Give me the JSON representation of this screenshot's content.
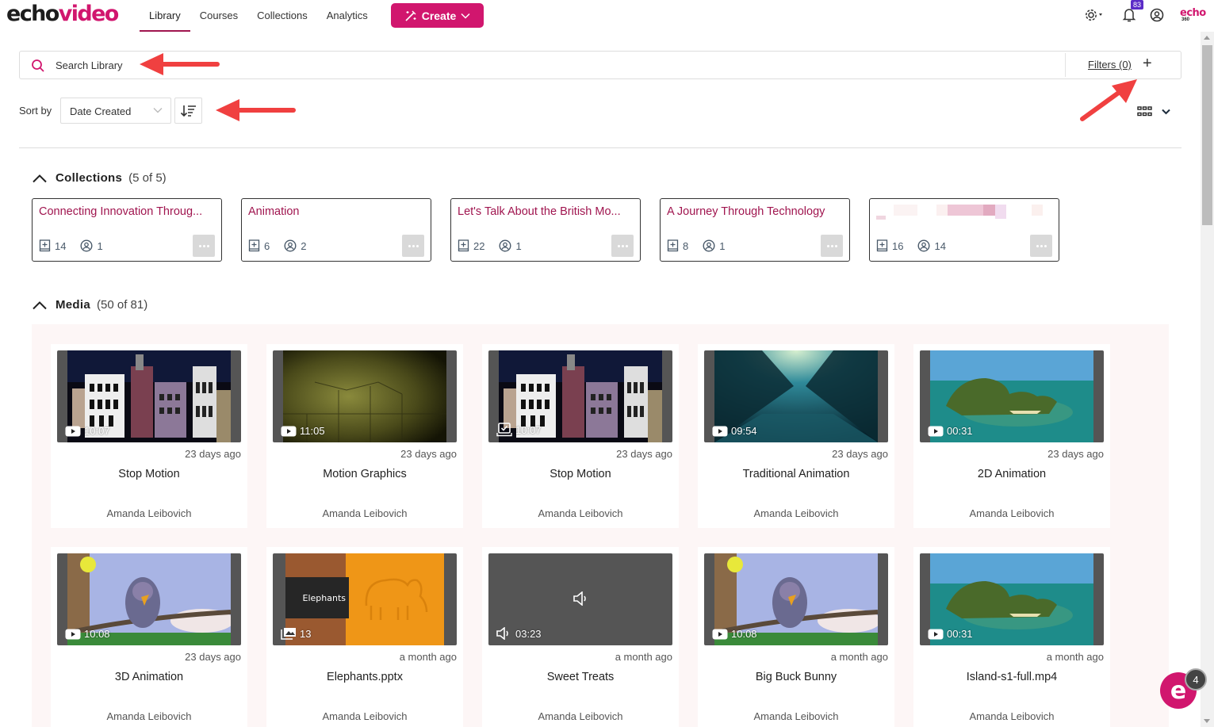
{
  "brand": {
    "logo_part1": "echo",
    "logo_part2": "video",
    "accent": "#d1166e",
    "secondary_logo_top": "echo",
    "secondary_logo_bottom": "360"
  },
  "nav": {
    "items": [
      {
        "label": "Library",
        "active": true
      },
      {
        "label": "Courses"
      },
      {
        "label": "Collections"
      },
      {
        "label": "Analytics"
      }
    ],
    "create_label": "Create",
    "notifications_count": "83",
    "icons": [
      "wand-icon",
      "chevron-down-icon",
      "gear-icon",
      "bell-icon",
      "user-icon"
    ]
  },
  "search": {
    "placeholder": "Search Library",
    "value": "",
    "filters_label": "Filters (0)",
    "filters_add": "+"
  },
  "sort": {
    "label": "Sort by",
    "selected": "Date Created"
  },
  "collections": {
    "title": "Collections",
    "count": "(5 of 5)",
    "items": [
      {
        "title": "Connecting Innovation Throug...",
        "media_count": "14",
        "member_count": "1"
      },
      {
        "title": "Animation",
        "media_count": "6",
        "member_count": "2"
      },
      {
        "title": "Let's Talk About the British Mo...",
        "media_count": "22",
        "member_count": "1"
      },
      {
        "title": "A Journey Through Technology",
        "media_count": "8",
        "member_count": "1"
      },
      {
        "title": "",
        "media_count": "16",
        "member_count": "14",
        "title_redacted": true
      }
    ]
  },
  "media": {
    "title": "Media",
    "count": "(50 of 81)",
    "items": [
      {
        "title": "Stop Motion",
        "duration": "10:07",
        "type": "video",
        "date": "23 days ago",
        "owner": "Amanda Leibovich",
        "thumb": "town"
      },
      {
        "title": "Motion Graphics",
        "duration": "11:05",
        "type": "video",
        "date": "23 days ago",
        "owner": "Amanda Leibovich",
        "thumb": "stone"
      },
      {
        "title": "Stop Motion",
        "duration": "10:07",
        "type": "capture",
        "date": "23 days ago",
        "owner": "Amanda Leibovich",
        "thumb": "town"
      },
      {
        "title": "Traditional Animation",
        "duration": "09:54",
        "type": "video",
        "date": "23 days ago",
        "owner": "Amanda Leibovich",
        "thumb": "ocean"
      },
      {
        "title": "2D Animation",
        "duration": "00:31",
        "type": "video",
        "date": "23 days ago",
        "owner": "Amanda Leibovich",
        "thumb": "island"
      },
      {
        "title": "3D Animation",
        "duration": "10:08",
        "type": "video",
        "date": "23 days ago",
        "owner": "Amanda Leibovich",
        "thumb": "bird"
      },
      {
        "title": "Elephants.pptx",
        "duration": "13",
        "type": "presentation",
        "date": "a month ago",
        "owner": "Amanda Leibovich",
        "thumb": "elephant",
        "slide_label": "Elephants"
      },
      {
        "title": "Sweet Treats",
        "duration": "03:23",
        "type": "audio",
        "date": "a month ago",
        "owner": "Amanda Leibovich",
        "thumb": "audio"
      },
      {
        "title": "Big Buck Bunny",
        "duration": "10:08",
        "type": "video",
        "date": "a month ago",
        "owner": "Amanda Leibovich",
        "thumb": "bird"
      },
      {
        "title": "Island-s1-full.mp4",
        "duration": "00:31",
        "type": "video",
        "date": "a month ago",
        "owner": "Amanda Leibovich",
        "thumb": "island"
      }
    ]
  },
  "chat": {
    "label": "e",
    "badge": "4"
  }
}
